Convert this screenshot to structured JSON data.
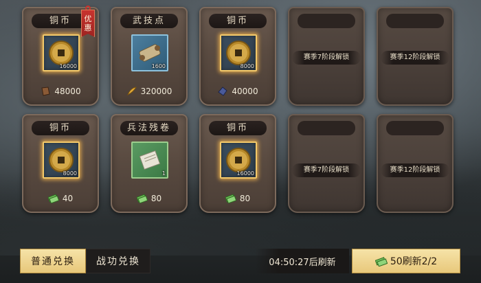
{
  "cards": [
    {
      "title": "铜币",
      "qty": "16000",
      "price": "48000",
      "badge": "优惠",
      "item_icon": "copper-coin-icon",
      "currency_icon": "leather-token-icon"
    },
    {
      "title": "武技点",
      "qty": "1600",
      "price": "320000",
      "item_icon": "scroll-icon",
      "currency_icon": "feather-token-icon"
    },
    {
      "title": "铜币",
      "qty": "8000",
      "price": "40000",
      "item_icon": "copper-coin-icon",
      "currency_icon": "crystal-token-icon"
    },
    {
      "title": "",
      "lock_text": "赛季7阶段解锁"
    },
    {
      "title": "",
      "lock_text": "赛季12阶段解锁"
    },
    {
      "title": "铜币",
      "qty": "8000",
      "price": "40",
      "item_icon": "copper-coin-icon",
      "currency_icon": "cash-icon"
    },
    {
      "title": "兵法残卷",
      "qty": "1",
      "price": "80",
      "item_icon": "manual-fragment-icon",
      "currency_icon": "cash-icon"
    },
    {
      "title": "铜币",
      "qty": "16000",
      "price": "80",
      "item_icon": "copper-coin-icon",
      "currency_icon": "cash-icon"
    },
    {
      "title": "",
      "lock_text": "赛季7阶段解锁"
    },
    {
      "title": "",
      "lock_text": "赛季12阶段解锁"
    }
  ],
  "tabs": {
    "normal": "普通兑换",
    "merit": "战功兑换"
  },
  "timer": "04:50:27后刷新",
  "refresh": {
    "label": "50刷新2/2",
    "icon": "cash-icon"
  },
  "colors": {
    "gold_frame": "#f3c96a",
    "card_bg": "#5a4b41",
    "badge_red": "#c8332e",
    "button_gold": "#e8c87b"
  }
}
